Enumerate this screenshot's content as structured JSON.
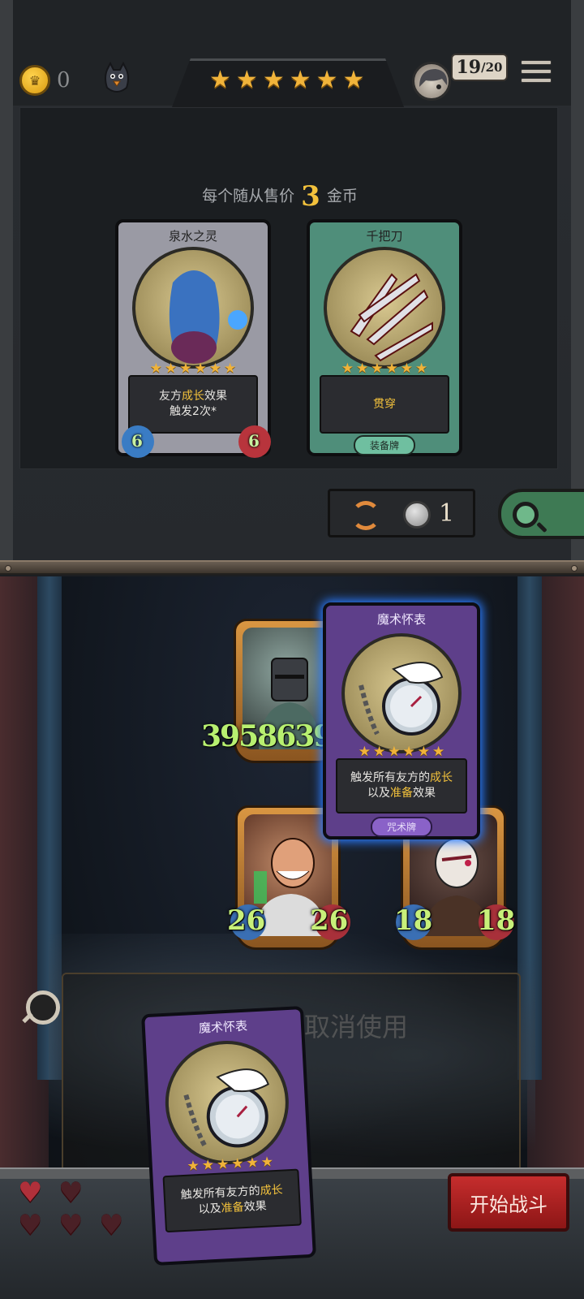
{
  "hud": {
    "gold": "0",
    "gold_icon": "crown-coin-icon",
    "rank_stars": 6,
    "level_current": "19",
    "level_max": "/20",
    "menu_icon": "hamburger-menu-icon"
  },
  "shop": {
    "price_prefix": "每个随从售价",
    "price_value": "3",
    "price_suffix": "金币",
    "cards": [
      {
        "name": "泉水之灵",
        "stars": 6,
        "desc_pre": "友方",
        "desc_hl": "成长",
        "desc_post": "效果",
        "desc_line2": "触发2次*",
        "attack": "6",
        "health": "6",
        "frame_color": "#9a9aa4"
      },
      {
        "name": "千把刀",
        "stars": 6,
        "desc_hl": "贯穿",
        "type": "装备牌",
        "frame_color": "#4f8e7a"
      }
    ],
    "reroll_cost": "1"
  },
  "board": {
    "big_stat": "395863",
    "big_stat_overlap": "9",
    "minions": [
      {
        "attack": "26",
        "health": "26"
      },
      {
        "attack": "18",
        "health": "18"
      }
    ],
    "hover_card": {
      "name": "魔术怀表",
      "stars": 6,
      "line1_pre": "触发所有友方的",
      "line1_hl": "成长",
      "line2_pre": "以及",
      "line2_hl": "准备",
      "line2_post": "效果",
      "type": "咒术牌"
    },
    "cancel_text": "拖动到此处取消使用"
  },
  "hand_card": {
    "name": "魔术怀表",
    "stars": 6,
    "line1_pre": "触发所有友方的",
    "line1_hl": "成长",
    "line2_pre": "以及",
    "line2_hl": "准备",
    "line2_post": "效果"
  },
  "lives": 5,
  "start_button": "开始战斗"
}
